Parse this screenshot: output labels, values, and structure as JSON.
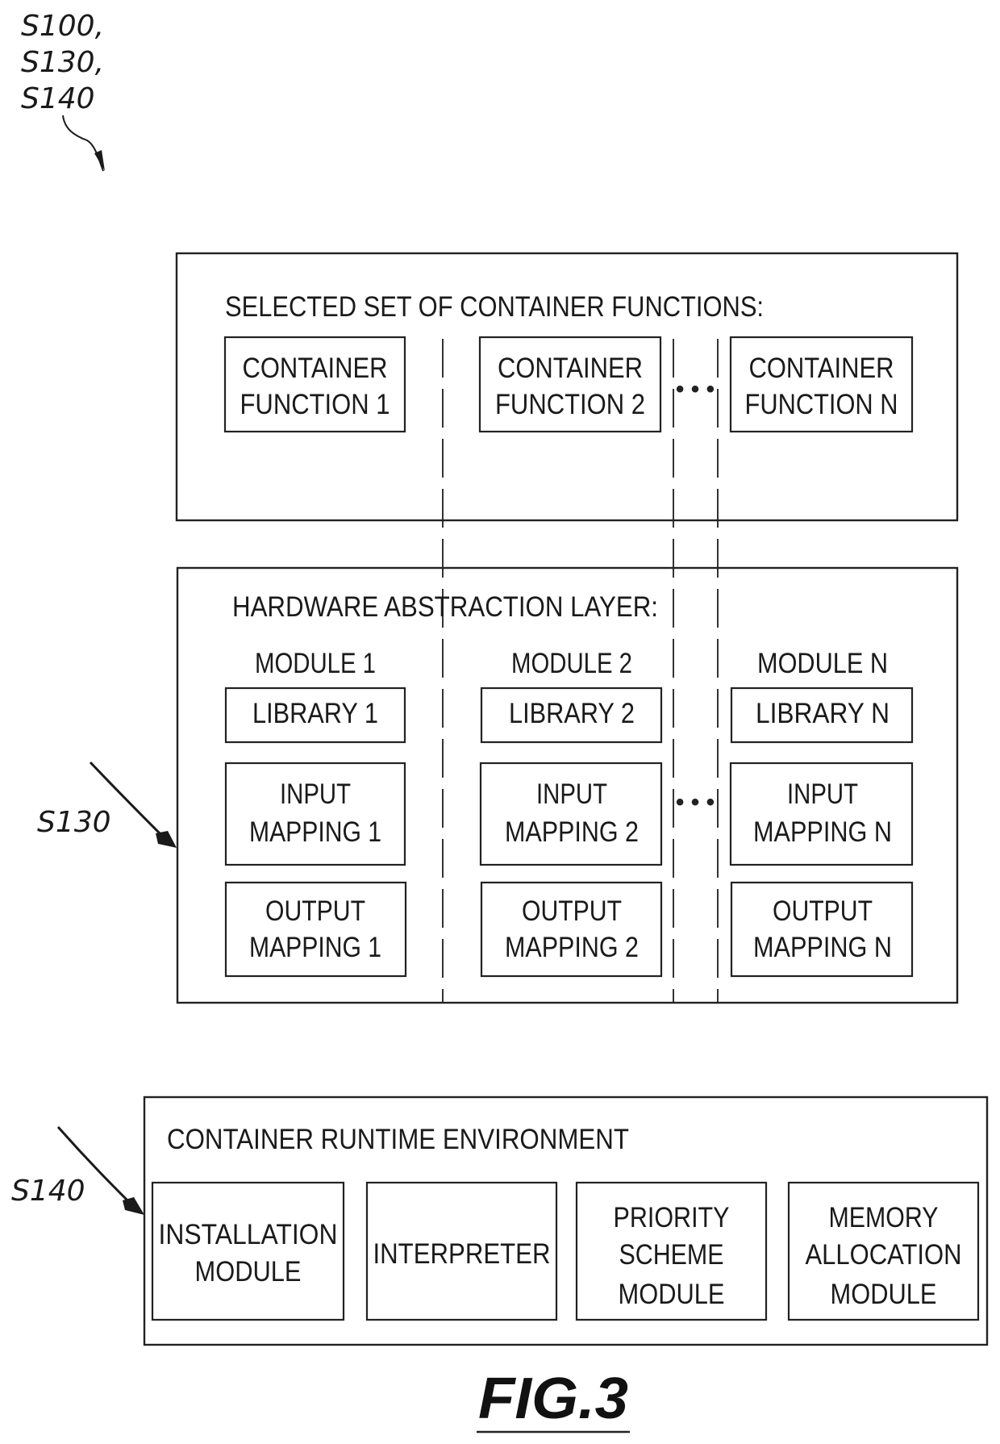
{
  "reference_labels": {
    "top_group": [
      "S100,",
      "S130,",
      "S140"
    ],
    "hal_ref": "S130",
    "cre_ref": "S140"
  },
  "container_functions": {
    "title": "SELECTED SET OF CONTAINER FUNCTIONS:",
    "items": [
      {
        "line1": "CONTAINER",
        "line2": "FUNCTION 1"
      },
      {
        "line1": "CONTAINER",
        "line2": "FUNCTION 2"
      },
      {
        "line1": "CONTAINER",
        "line2": "FUNCTION N"
      }
    ],
    "ellipsis": "• • •"
  },
  "hardware_abstraction_layer": {
    "title": "HARDWARE ABSTRACTION LAYER:",
    "ellipsis": "• • •",
    "modules": [
      {
        "name": "MODULE 1",
        "library": "LIBRARY 1",
        "input": [
          "INPUT",
          "MAPPING 1"
        ],
        "output": [
          "OUTPUT",
          "MAPPING 1"
        ]
      },
      {
        "name": "MODULE 2",
        "library": "LIBRARY 2",
        "input": [
          "INPUT",
          "MAPPING 2"
        ],
        "output": [
          "OUTPUT",
          "MAPPING 2"
        ]
      },
      {
        "name": "MODULE N",
        "library": "LIBRARY N",
        "input": [
          "INPUT",
          "MAPPING N"
        ],
        "output": [
          "OUTPUT",
          "MAPPING N"
        ]
      }
    ]
  },
  "container_runtime_environment": {
    "title": "CONTAINER RUNTIME ENVIRONMENT",
    "items": [
      {
        "lines": [
          "INSTALLATION",
          "MODULE"
        ]
      },
      {
        "lines": [
          "INTERPRETER"
        ]
      },
      {
        "lines": [
          "PRIORITY",
          "SCHEME",
          "MODULE"
        ]
      },
      {
        "lines": [
          "MEMORY",
          "ALLOCATION",
          "MODULE"
        ]
      }
    ]
  },
  "figure_label": "FIG.3"
}
